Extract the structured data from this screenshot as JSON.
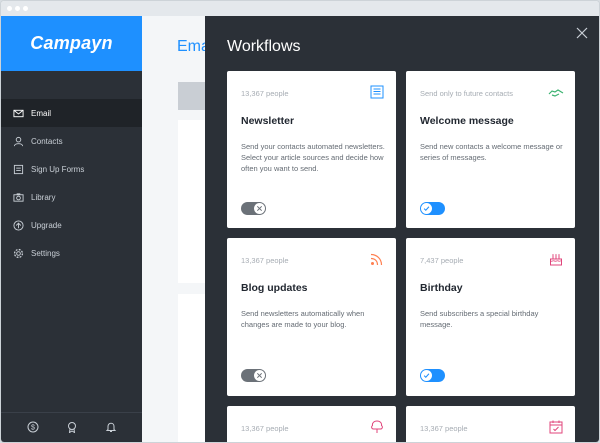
{
  "app": {
    "logo": "Campayn",
    "brand_color": "#1e90ff"
  },
  "sidebar": {
    "items": [
      {
        "label": "Email",
        "icon": "envelope-icon",
        "active": true
      },
      {
        "label": "Contacts",
        "icon": "person-icon",
        "active": false
      },
      {
        "label": "Sign Up Forms",
        "icon": "form-icon",
        "active": false
      },
      {
        "label": "Library",
        "icon": "camera-icon",
        "active": false
      },
      {
        "label": "Upgrade",
        "icon": "arrow-up-circle-icon",
        "active": false
      },
      {
        "label": "Settings",
        "icon": "gear-icon",
        "active": false
      }
    ],
    "footer_icons": [
      "dollar-circle-icon",
      "award-badge-icon",
      "bell-icon"
    ]
  },
  "main": {
    "title": "Ema"
  },
  "workflows": {
    "title": "Workflows",
    "cards": [
      {
        "count": "13,367 people",
        "name": "Newsletter",
        "description": "Send your contacts automated newsletters. Select your article sources and decide how often you want to send.",
        "enabled": false,
        "icon": "newsletter-icon",
        "icon_color": "#1e90ff"
      },
      {
        "count": "Send only to future contacts",
        "name": "Welcome message",
        "description": "Send new contacts a welcome message or series of messages.",
        "enabled": true,
        "icon": "handshake-icon",
        "icon_color": "#3cb371"
      },
      {
        "count": "13,367 people",
        "name": "Blog updates",
        "description": "Send newsletters automatically when changes are made to your blog.",
        "enabled": false,
        "icon": "rss-icon",
        "icon_color": "#ff7f50"
      },
      {
        "count": "7,437 people",
        "name": "Birthday",
        "description": "Send subscribers a special birthday message.",
        "enabled": true,
        "icon": "cake-icon",
        "icon_color": "#e0457b"
      },
      {
        "count": "13,367 people",
        "name": "",
        "description": "",
        "enabled": null,
        "icon": "tree-icon",
        "icon_color": "#e0457b"
      },
      {
        "count": "13,367 people",
        "name": "",
        "description": "",
        "enabled": null,
        "icon": "calendar-icon",
        "icon_color": "#e0457b"
      }
    ]
  }
}
